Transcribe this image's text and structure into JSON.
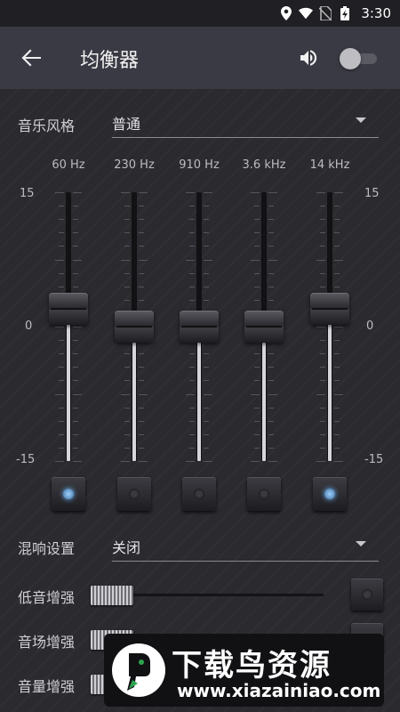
{
  "status_bar": {
    "time": "3:30",
    "icons": [
      "location-icon",
      "wifi-icon",
      "no-sim-icon",
      "battery-charging-icon"
    ]
  },
  "app_bar": {
    "title": "均衡器",
    "back_icon": "back-arrow-icon",
    "volume_icon": "volume-icon",
    "toggle_on": false
  },
  "preset": {
    "label": "音乐风格",
    "value": "普通"
  },
  "equalizer": {
    "scale_max": "15",
    "scale_mid": "0",
    "scale_min": "-15",
    "bands": [
      {
        "freq": "60 Hz",
        "level_db": 2,
        "enabled": true
      },
      {
        "freq": "230 Hz",
        "level_db": 0,
        "enabled": false
      },
      {
        "freq": "910 Hz",
        "level_db": 0,
        "enabled": false
      },
      {
        "freq": "3.6 kHz",
        "level_db": 0,
        "enabled": false
      },
      {
        "freq": "14 kHz",
        "level_db": 2,
        "enabled": true
      }
    ]
  },
  "reverb": {
    "label": "混响设置",
    "value": "关闭"
  },
  "effects": [
    {
      "label": "低音增强",
      "level": 0.0
    },
    {
      "label": "音场增强",
      "level": 0.0
    },
    {
      "label": "音量增强",
      "level": 0.0
    }
  ],
  "watermark": {
    "title": "下载鸟资源",
    "url": "www.xiazainiao.com"
  },
  "colors": {
    "app_bar": "#3a3a44",
    "background": "#2a2a2f",
    "led_on": "#6bb6ff"
  }
}
